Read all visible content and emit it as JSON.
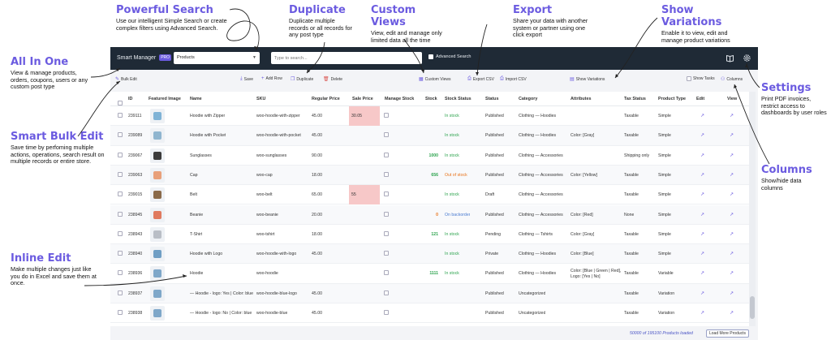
{
  "annotations": {
    "powerful_search": {
      "title": "Powerful Search",
      "text": "Use our intelligent Simple Search or create complex filters using Advanced Search."
    },
    "duplicate": {
      "title": "Duplicate",
      "text": "Duplicate multiple records or all records for any post type"
    },
    "custom_views": {
      "title": "Custom Views",
      "text": "View, edit and manage only limited data all the time"
    },
    "export": {
      "title": "Export",
      "text": "Share your data with another system or partner using one click export"
    },
    "show_variations": {
      "title": "Show Variations",
      "text": "Enable it to view, edit and manage product variations"
    },
    "all_in_one": {
      "title": "All In One",
      "text": "View & manage products, orders, coupons, users or any custom post type"
    },
    "smart_bulk_edit": {
      "title": "Smart Bulk Edit",
      "text": "Save time by perfoming multiple actions, operations, search result on multiple records or entire store."
    },
    "inline_edit": {
      "title": "Inline Edit",
      "text": "Make multiple changes just like you do in Excel and save them at once."
    },
    "settings": {
      "title": "Settings",
      "text": "Print PDF invoices, restrict access to dashboards by user roles"
    },
    "columns": {
      "title": "Columns",
      "text": "Show/hide data columns"
    }
  },
  "topbar": {
    "brand": "Smart Manager",
    "pro": "PRO",
    "post_type": "Products",
    "search_placeholder": "Type to search...",
    "advanced_search": "Advanced Search",
    "icons": [
      "book-icon",
      "gear-icon"
    ]
  },
  "toolbar": {
    "bulk_edit": "Bulk Edit",
    "save": "Save",
    "add_row": "Add Row",
    "duplicate": "Duplicate",
    "delete": "Delete",
    "custom_views": "Custom Views",
    "export_csv": "Export CSV",
    "import_csv": "Import CSV",
    "show_variations": "Show Variations",
    "show_tasks": "Show Tasks",
    "columns": "Columns"
  },
  "columns": [
    "ID",
    "Featured Image",
    "Name",
    "SKU",
    "Regular Price",
    "Sale Price",
    "Manage Stock",
    "Stock",
    "Stock Status",
    "Status",
    "Category",
    "Attributes",
    "Tax Status",
    "Product Type",
    "Edit",
    "View"
  ],
  "rows": [
    {
      "id": "239111",
      "name": "Hoodie with Zipper",
      "sku": "woo-hoodie-with-zipper",
      "regular": "45.00",
      "sale": "30.05",
      "stock": "",
      "stock_status": "In stock",
      "status": "Published",
      "category": "Clothing — Hoodies",
      "attributes": "",
      "tax": "Taxable",
      "type": "Simple"
    },
    {
      "id": "239089",
      "name": "Hoodie with Pocket",
      "sku": "woo-hoodie-with-pocket",
      "regular": "45.00",
      "sale": "",
      "stock": "",
      "stock_status": "In stock",
      "status": "Published",
      "category": "Clothing — Hoodies",
      "attributes": "Color: [Gray]",
      "tax": "Taxable",
      "type": "Simple"
    },
    {
      "id": "239067",
      "name": "Sunglasses",
      "sku": "woo-sunglasses",
      "regular": "90.00",
      "sale": "",
      "stock": "1000",
      "stock_status": "In stock",
      "status": "Published",
      "category": "Clothing — Accessories",
      "attributes": "",
      "tax": "Shipping only",
      "type": "Simple"
    },
    {
      "id": "239063",
      "name": "Cap",
      "sku": "woo-cap",
      "regular": "18.00",
      "sale": "",
      "stock": "656",
      "stock_status": "Out of stock",
      "status": "Published",
      "category": "Clothing — Accessories",
      "attributes": "Color: [Yellow]",
      "tax": "Taxable",
      "type": "Simple"
    },
    {
      "id": "239015",
      "name": "Belt",
      "sku": "woo-belt",
      "regular": "65.00",
      "sale": "55",
      "stock": "",
      "stock_status": "In stock",
      "status": "Draft",
      "category": "Clothing — Accessories",
      "attributes": "",
      "tax": "Taxable",
      "type": "Simple"
    },
    {
      "id": "238945",
      "name": "Beanie",
      "sku": "woo-beanie",
      "regular": "20.00",
      "sale": "",
      "stock": "0",
      "stock_status": "On backorder",
      "status": "Published",
      "category": "Clothing — Accessories",
      "attributes": "Color: [Red]",
      "tax": "None",
      "type": "Simple"
    },
    {
      "id": "238943",
      "name": "T-Shirt",
      "sku": "woo-tshirt",
      "regular": "18.00",
      "sale": "",
      "stock": "121",
      "stock_status": "In stock",
      "status": "Pending",
      "category": "Clothing — Tshirts",
      "attributes": "Color: [Gray]",
      "tax": "Taxable",
      "type": "Simple"
    },
    {
      "id": "238940",
      "name": "Hoodie with Logo",
      "sku": "woo-hoodie-with-logo",
      "regular": "45.00",
      "sale": "",
      "stock": "",
      "stock_status": "In stock",
      "status": "Private",
      "category": "Clothing — Hoodies",
      "attributes": "Color: [Blue]",
      "tax": "Taxable",
      "type": "Simple"
    },
    {
      "id": "238936",
      "name": "Hoodie",
      "sku": "woo-hoodie",
      "regular": "",
      "sale": "",
      "stock": "1111",
      "stock_status": "In stock",
      "status": "Published",
      "category": "Clothing — Hoodies",
      "attributes": "Color: [Blue | Green | Red], Logo: [Yes | No]",
      "tax": "Taxable",
      "type": "Variable"
    },
    {
      "id": "238937",
      "name": "— Hoodie - logo: Yes | Color: blue",
      "sku": "woo-hoodie-blue-logo",
      "regular": "45.00",
      "sale": "",
      "stock": "",
      "stock_status": "",
      "status": "Published",
      "category": "Uncategorized",
      "attributes": "",
      "tax": "Taxable",
      "type": "Variation"
    },
    {
      "id": "238938",
      "name": "— Hoodie - logo: No | Color: blue",
      "sku": "woo-hoodie-blue",
      "regular": "45.00",
      "sale": "",
      "stock": "",
      "stock_status": "",
      "status": "Published",
      "category": "Uncategorized",
      "attributes": "",
      "tax": "Taxable",
      "type": "Variation"
    }
  ],
  "footer": {
    "loaded": "50000 of 195100 Products loaded",
    "load_more": "Load More Products"
  },
  "colors": {
    "accent": "#6b5be0",
    "topbar": "#1f2a36",
    "sale_highlight": "#f7c8c8",
    "in_stock": "#2ea44f",
    "out_of_stock": "#e8731a",
    "backorder": "#4a7bd0"
  }
}
